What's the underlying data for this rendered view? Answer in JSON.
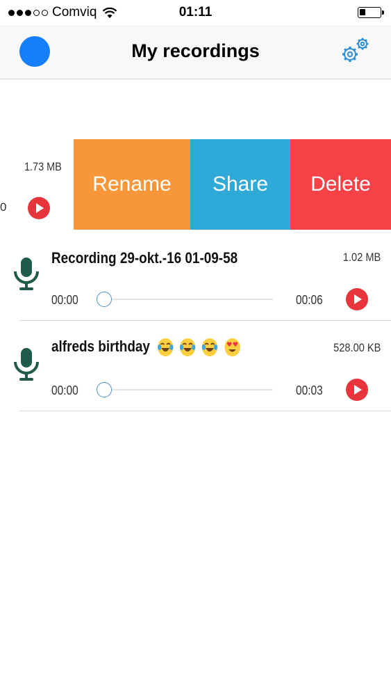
{
  "status_bar": {
    "signal_dots_filled": 3,
    "signal_dots_total": 5,
    "carrier": "Comviq",
    "time": "01:11",
    "battery_level": 0.3
  },
  "nav": {
    "title": "My recordings",
    "avatar_color": "#147efb",
    "settings_icon": "gear-icon"
  },
  "swiped_row": {
    "size": "1.73 MB",
    "partial_time": "0",
    "actions": {
      "rename": "Rename",
      "share": "Share",
      "delete": "Delete"
    },
    "colors": {
      "rename": "#f7973a",
      "share": "#2ea9d8",
      "delete": "#f64147"
    }
  },
  "recordings": [
    {
      "title": "Recording 29-okt.-16 01-09-58",
      "size": "1.02 MB",
      "current_time": "00:00",
      "duration": "00:06",
      "progress": 0,
      "icon": "microphone-icon"
    },
    {
      "title": "alfreds birthday",
      "title_emojis": [
        "tears-of-joy",
        "tears-of-joy",
        "tears-of-joy",
        "heart-eyes"
      ],
      "size": "528.00 KB",
      "current_time": "00:00",
      "duration": "00:03",
      "progress": 0,
      "icon": "microphone-icon"
    }
  ],
  "colors": {
    "accent_blue": "#147efb",
    "play_red": "#e8343b",
    "mic_green": "#1f5a4a"
  }
}
